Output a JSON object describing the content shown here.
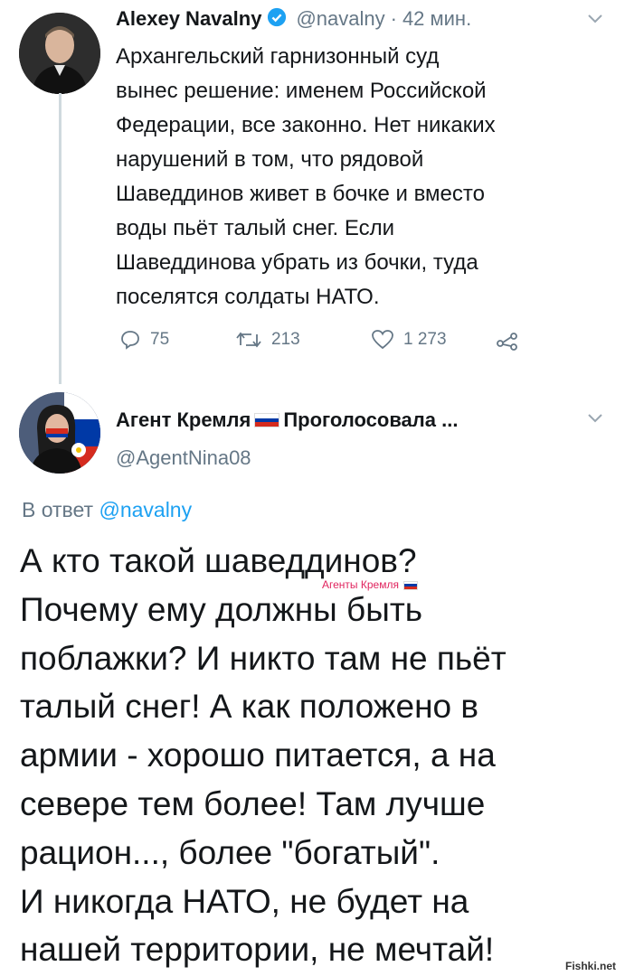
{
  "tweet1": {
    "author_name": "Alexey Navalny",
    "handle": "@navalny",
    "separator": "·",
    "time": "42 мин.",
    "text": "Архангельский гарнизонный суд\nвынес решение: именем Российской\nФедерации, все законно. Нет никаких\nнарушений в том, что рядовой\nШаведдинов живет в бочке и вместо\nводы пьёт талый снег. Если\nШаведдинова убрать из бочки, туда\nпоселятся солдаты НАТО.",
    "replies": "75",
    "retweets": "213",
    "likes": "1 273"
  },
  "tweet2": {
    "author_name_part1": "Агент Кремля",
    "author_name_part2": "Проголосовала ...",
    "handle": "@AgentNina08",
    "reply_prefix": "В ответ",
    "reply_to": "@navalny",
    "text": "А кто такой шаведдинов?\nПочему ему должны быть\nпоблажки? И никто там не пьёт\nталый снег! А как положено в\nармии - хорошо питается, а на\nсевере тем более! Там лучше\nрацион..., более \"богатый\".\nИ никогда НАТО, не будет на\nнашей территории, не мечтай!",
    "watermark": "Агенты Кремля"
  },
  "site_watermark": "Fishki.net",
  "colors": {
    "accent": "#1da1f2",
    "muted": "#657786",
    "text": "#14171a",
    "flag": [
      "#ffffff",
      "#0039a6",
      "#d52b1e"
    ]
  }
}
